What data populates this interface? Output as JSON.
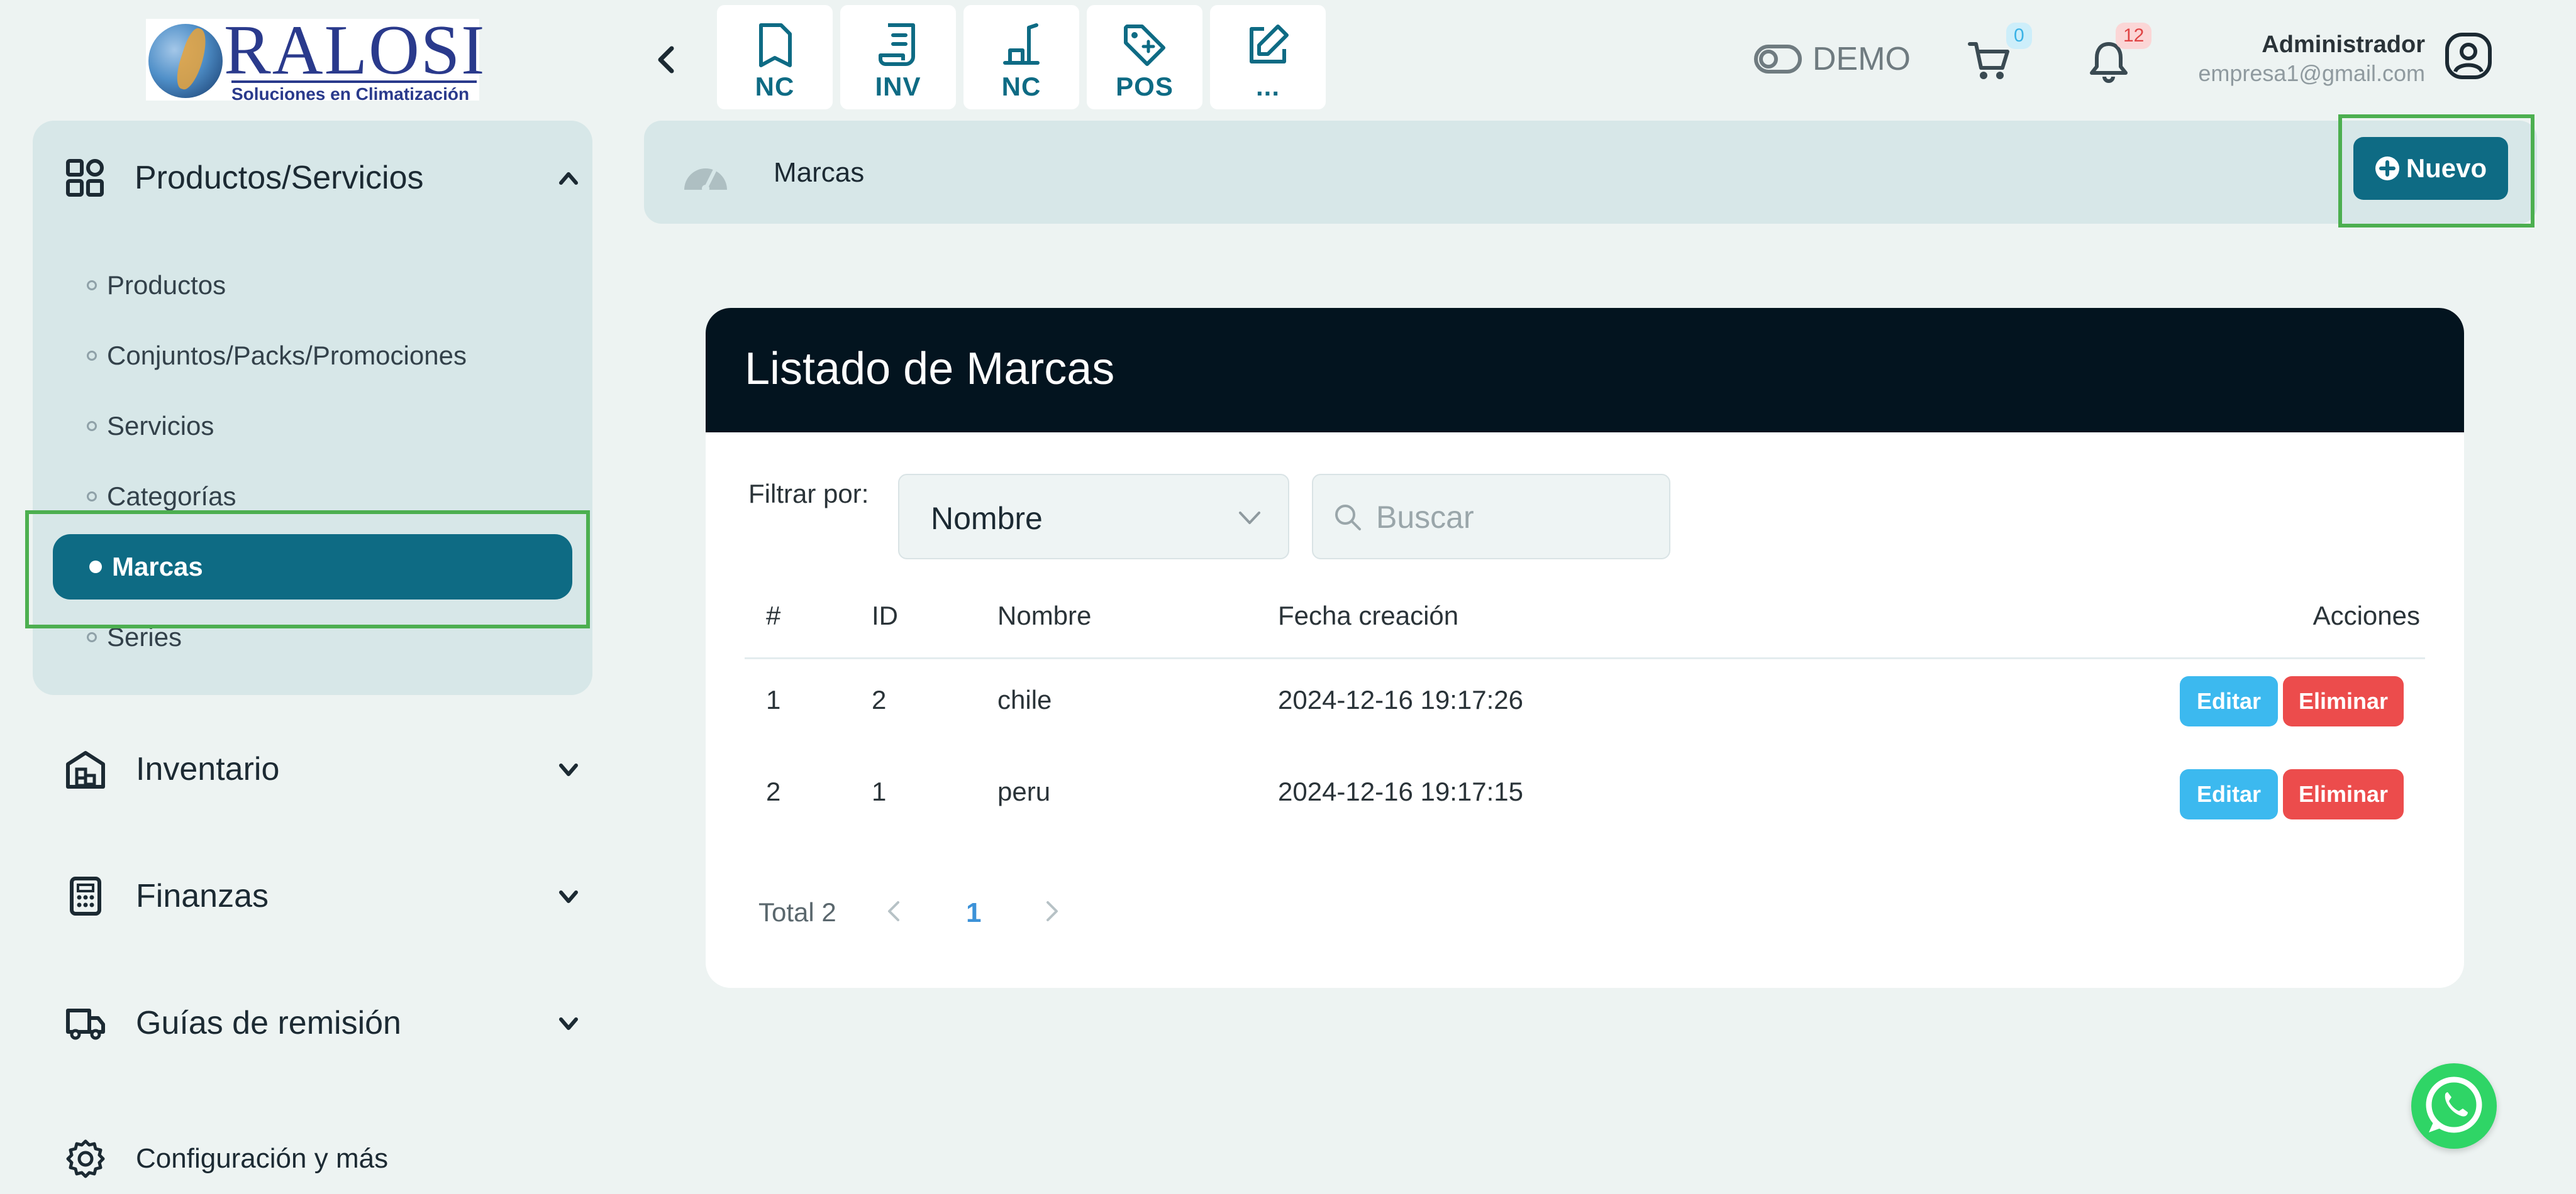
{
  "header": {
    "logo": {
      "name": "RALOSI",
      "tagline": "Soluciones en Climatización"
    },
    "quick_actions": [
      {
        "label": "NC",
        "icon": "file-icon"
      },
      {
        "label": "INV",
        "icon": "scroll-icon"
      },
      {
        "label": "NC",
        "icon": "tool-icon"
      },
      {
        "label": "POS",
        "icon": "tag-icon"
      },
      {
        "label": "...",
        "icon": "edit-icon"
      }
    ],
    "demo_label": "DEMO",
    "cart_count": "0",
    "notification_count": "12",
    "user_name": "Administrador",
    "user_email": "empresa1@gmail.com"
  },
  "sidebar": {
    "section_title": "Productos/Servicios",
    "sub_items": [
      "Productos",
      "Conjuntos/Packs/Promociones",
      "Servicios",
      "Categorías",
      "Marcas",
      "Series"
    ],
    "active_item": "Marcas",
    "menus": [
      {
        "label": "Inventario",
        "icon": "warehouse-icon"
      },
      {
        "label": "Finanzas",
        "icon": "calculator-icon"
      },
      {
        "label": "Guías de remisión",
        "icon": "truck-icon"
      },
      {
        "label": "Configuración y más",
        "icon": "gear-icon"
      }
    ]
  },
  "breadcrumb": {
    "title": "Marcas",
    "new_button": "Nuevo"
  },
  "card": {
    "title": "Listado de Marcas",
    "filter_label": "Filtrar por:",
    "filter_value": "Nombre",
    "search_placeholder": "Buscar",
    "columns": [
      "#",
      "ID",
      "Nombre",
      "Fecha creación",
      "Acciones"
    ],
    "rows": [
      {
        "n": "1",
        "id": "2",
        "name": "chile",
        "date": "2024-12-16 19:17:26"
      },
      {
        "n": "2",
        "id": "1",
        "name": "peru",
        "date": "2024-12-16 19:17:15"
      }
    ],
    "edit_label": "Editar",
    "delete_label": "Eliminar",
    "total_label": "Total 2",
    "current_page": "1"
  },
  "colors": {
    "primary": "#0e6b84",
    "edit": "#3cb9ef",
    "delete": "#ec4c4c",
    "highlight": "#4caf50",
    "card_header": "#03141f"
  }
}
